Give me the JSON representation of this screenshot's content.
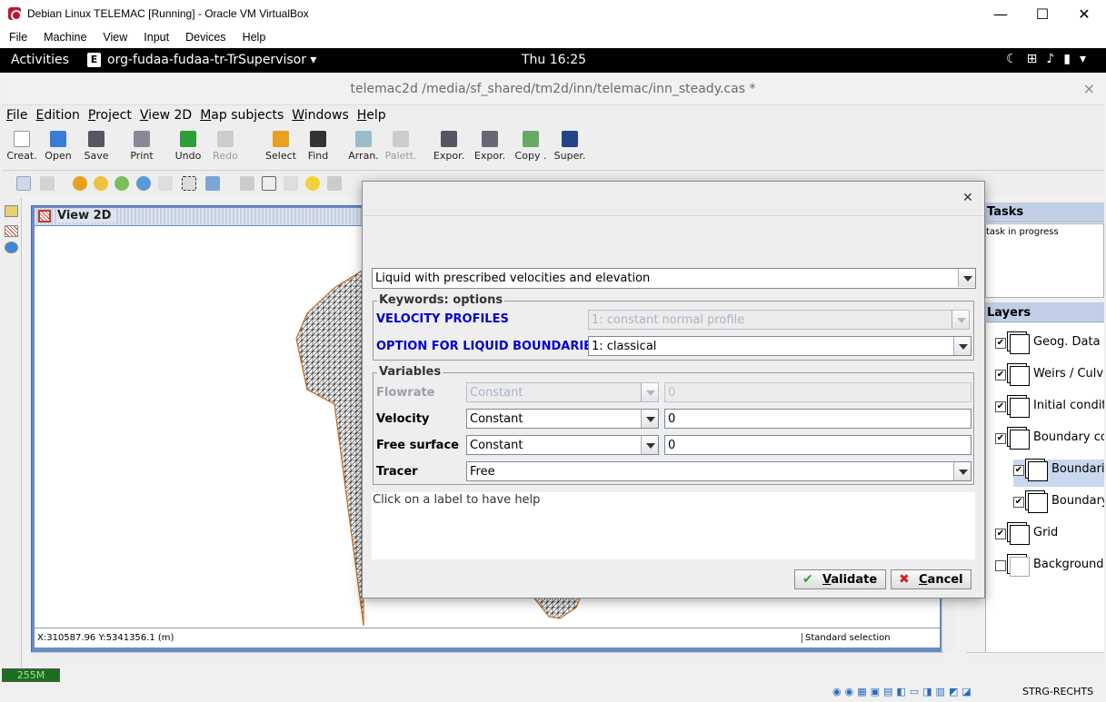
{
  "host_window": {
    "title": "Debian Linux TELEMAC [Running] - Oracle VM VirtualBox",
    "controls": {
      "minimize": "—",
      "maximize": "☐",
      "close": "✕"
    },
    "menu": [
      "File",
      "Machine",
      "View",
      "Input",
      "Devices",
      "Help"
    ]
  },
  "gnome_bar": {
    "activities": "Activities",
    "app_icon": "E",
    "app_name": "org-fudaa-fudaa-tr-TrSupervisor ▾",
    "clock": "Thu 16:25"
  },
  "app_window": {
    "title": "telemac2d /media/sf_shared/tm2d/inn/telemac/inn_steady.cas *",
    "close": "×",
    "menu": [
      "File",
      "Edition",
      "Project",
      "View 2D",
      "Map subjects",
      "Windows",
      "Help"
    ],
    "toolbar": [
      "Creat.",
      "Open",
      "Save",
      "Print",
      "Undo",
      "Redo",
      "Select",
      "Find",
      "Arran.",
      "Palett.",
      "Expor.",
      "Expor.",
      "Copy .",
      "Super."
    ]
  },
  "view2d": {
    "title": "View 2D",
    "coords": "X:310587.96 Y:5341356.1 (m)",
    "selection_mode": "Standard selection"
  },
  "memory": "255M",
  "tasks": {
    "title": "Tasks",
    "status": "task in progress"
  },
  "layers": {
    "title": "Layers",
    "items": [
      {
        "label": "Geog. Data",
        "checked": true
      },
      {
        "label": "Weirs / Culverts",
        "checked": true
      },
      {
        "label": "Initial conditions",
        "checked": true
      },
      {
        "label": "Boundary conditions",
        "checked": true
      },
      {
        "label": "Boundaries",
        "checked": true
      },
      {
        "label": "Boundary",
        "checked": true
      },
      {
        "label": "Grid",
        "checked": true
      },
      {
        "label": "Background",
        "checked": false
      }
    ]
  },
  "vbox_status": {
    "host_key": "STRG-RECHTS"
  },
  "dialog": {
    "close": "✕",
    "boundary_type": "Liquid with prescribed velocities and elevation",
    "keywords_group": "Keywords: options",
    "velocity_profiles_label": "VELOCITY PROFILES",
    "velocity_profiles_value": "1: constant normal profile",
    "liquid_boundaries_label": "OPTION FOR LIQUID BOUNDARIES",
    "liquid_boundaries_value": "1: classical",
    "variables_group": "Variables",
    "variables": [
      {
        "label": "Flowrate",
        "type": "Constant",
        "value": "0",
        "enabled": false
      },
      {
        "label": "Velocity",
        "type": "Constant",
        "value": "0",
        "enabled": true
      },
      {
        "label": "Free surface",
        "type": "Constant",
        "value": "0",
        "enabled": true
      },
      {
        "label": "Tracer",
        "type": "Free",
        "enabled": true
      }
    ],
    "help_text": "Click on a label to have help",
    "validate_label": "Validate",
    "cancel_label": "Cancel"
  },
  "colors": {
    "accent_blue": "#0000cc",
    "view_frame": "#6a8bc6",
    "panel_header": "#c0cfe6",
    "mesh_outline": "#c46a1a"
  }
}
